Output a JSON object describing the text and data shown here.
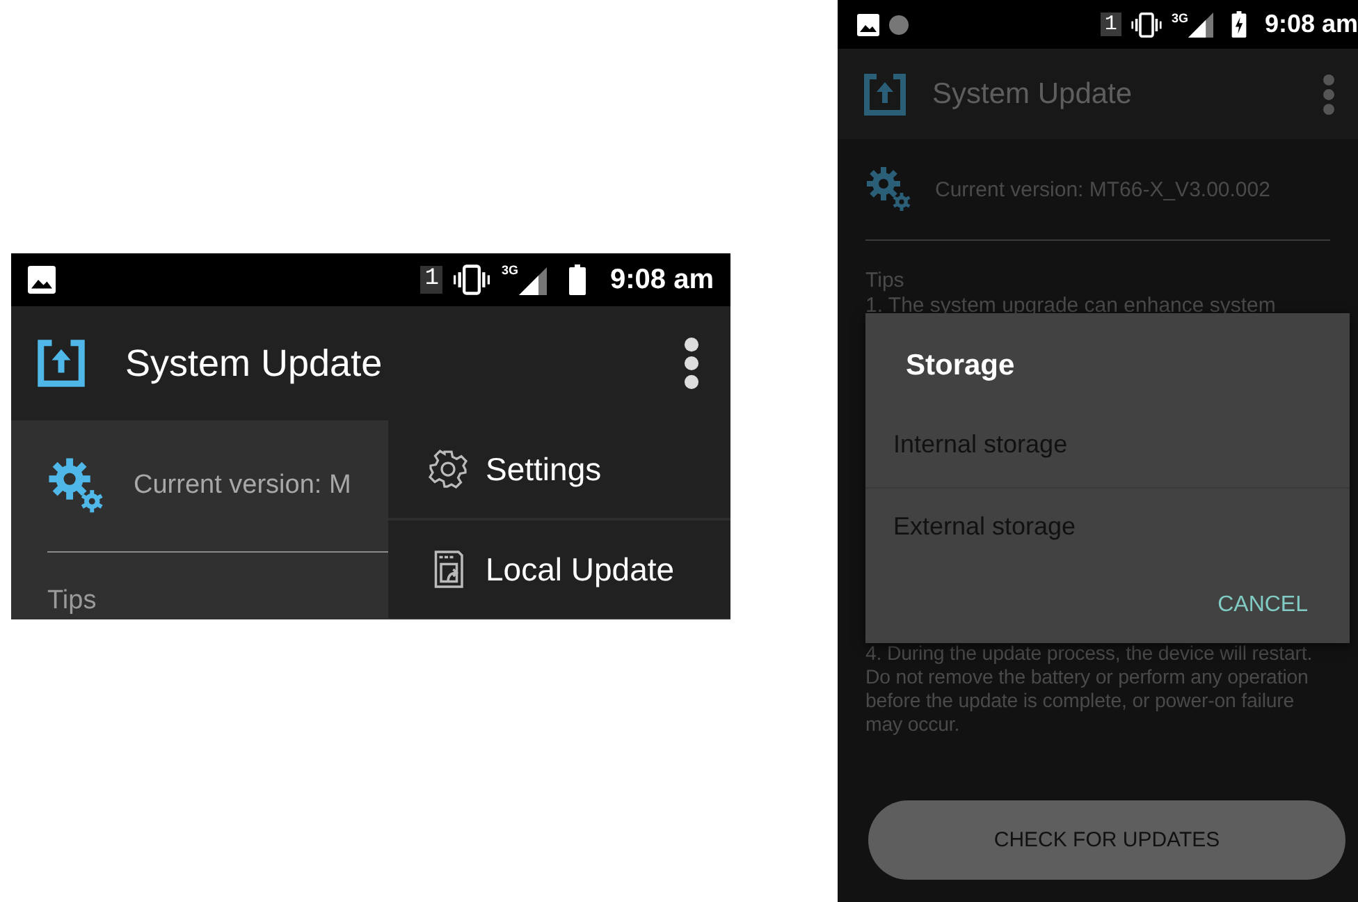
{
  "left_screen": {
    "status_bar": {
      "sim": "1",
      "network": "3G",
      "time": "9:08 am",
      "charging": false,
      "record_dot": false
    },
    "app_bar": {
      "title": "System Update"
    },
    "version": "Current version: M",
    "tips_heading": "Tips",
    "overflow_menu": {
      "items": [
        {
          "kind": "settings",
          "label": "Settings"
        },
        {
          "kind": "local-update",
          "label": "Local Update"
        }
      ]
    }
  },
  "right_screen": {
    "status_bar": {
      "sim": "1",
      "network": "3G",
      "time": "9:08 am",
      "charging": true,
      "record_dot": true
    },
    "app_bar": {
      "title": "System Update"
    },
    "version": "Current version: MT66-X_V3.00.002",
    "tips_heading": "Tips",
    "tips": [
      "1. The system upgrade can enhance system",
      "4. During the update process, the device will restart. Do not remove the battery or perform any operation before the update is complete, or power-on failure may occur."
    ],
    "dialog": {
      "title": "Storage",
      "options": [
        "Internal storage",
        "External storage"
      ],
      "cancel": "CANCEL"
    },
    "button": "CHECK FOR UPDATES"
  }
}
